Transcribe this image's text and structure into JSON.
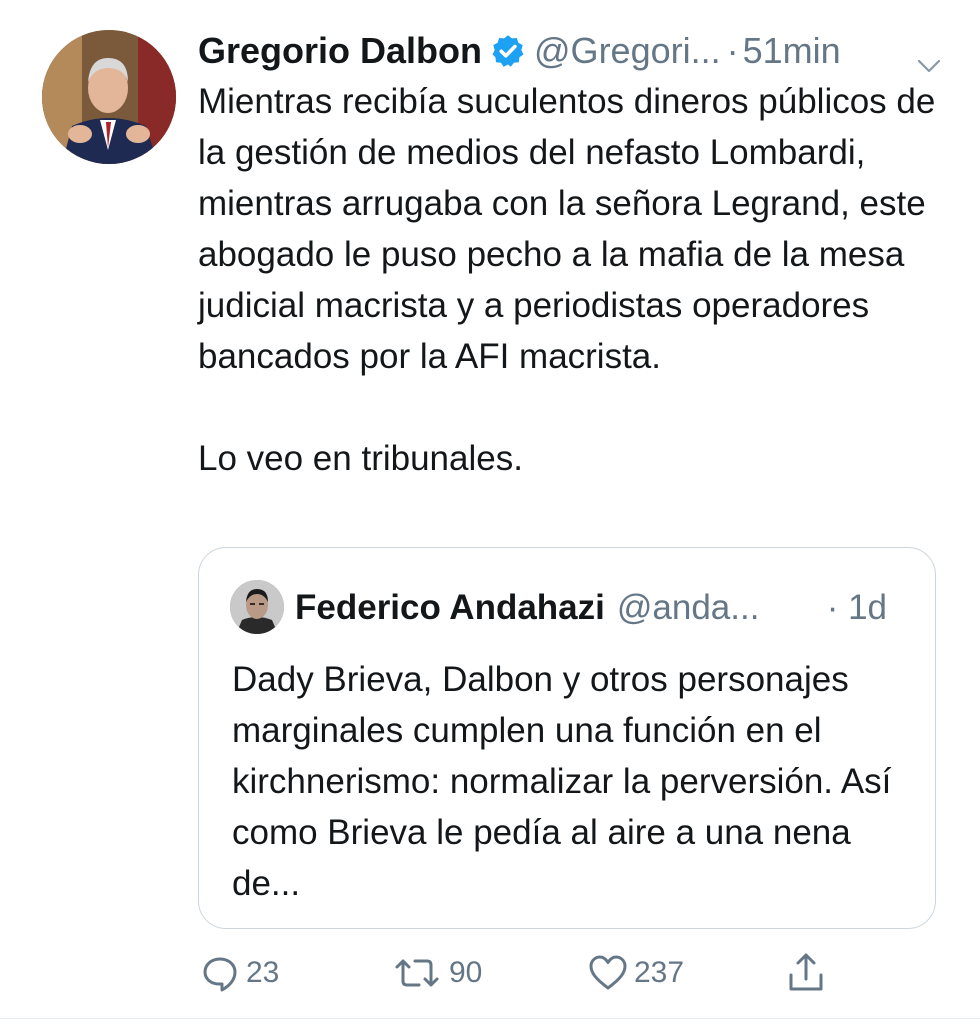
{
  "tweet": {
    "author_name": "Gregorio Dalbon",
    "author_handle": "@Gregori...",
    "separator": "·",
    "time": "51min",
    "text_paragraph_1": "Mientras recibía suculentos dineros públicos de la gestión de medios del nefasto Lombardi, mientras arrugaba con la señora Legrand, este abogado le puso pecho a la mafia de la mesa judicial macrista y a periodistas operadores bancados por la AFI macrista.",
    "text_paragraph_2": "Lo veo en tribunales."
  },
  "quoted_tweet": {
    "author_name": "Federico Andahazi",
    "author_handle": "@anda...",
    "time": "· 1d",
    "text": "Dady Brieva, Dalbon y otros personajes marginales cumplen una función en el kirchnerismo: normalizar la perversión. Así como Brieva le pedía al aire a una nena de..."
  },
  "actions": {
    "reply_count": "23",
    "retweet_count": "90",
    "like_count": "237"
  },
  "icons": {
    "verified": "verified-badge-icon",
    "caret": "chevron-down-icon",
    "reply": "reply-icon",
    "retweet": "retweet-icon",
    "like": "heart-icon",
    "share": "share-icon"
  },
  "colors": {
    "text": "#14171a",
    "secondary": "#657786",
    "verified_blue": "#1da1f2",
    "border": "#ccd6dd"
  }
}
